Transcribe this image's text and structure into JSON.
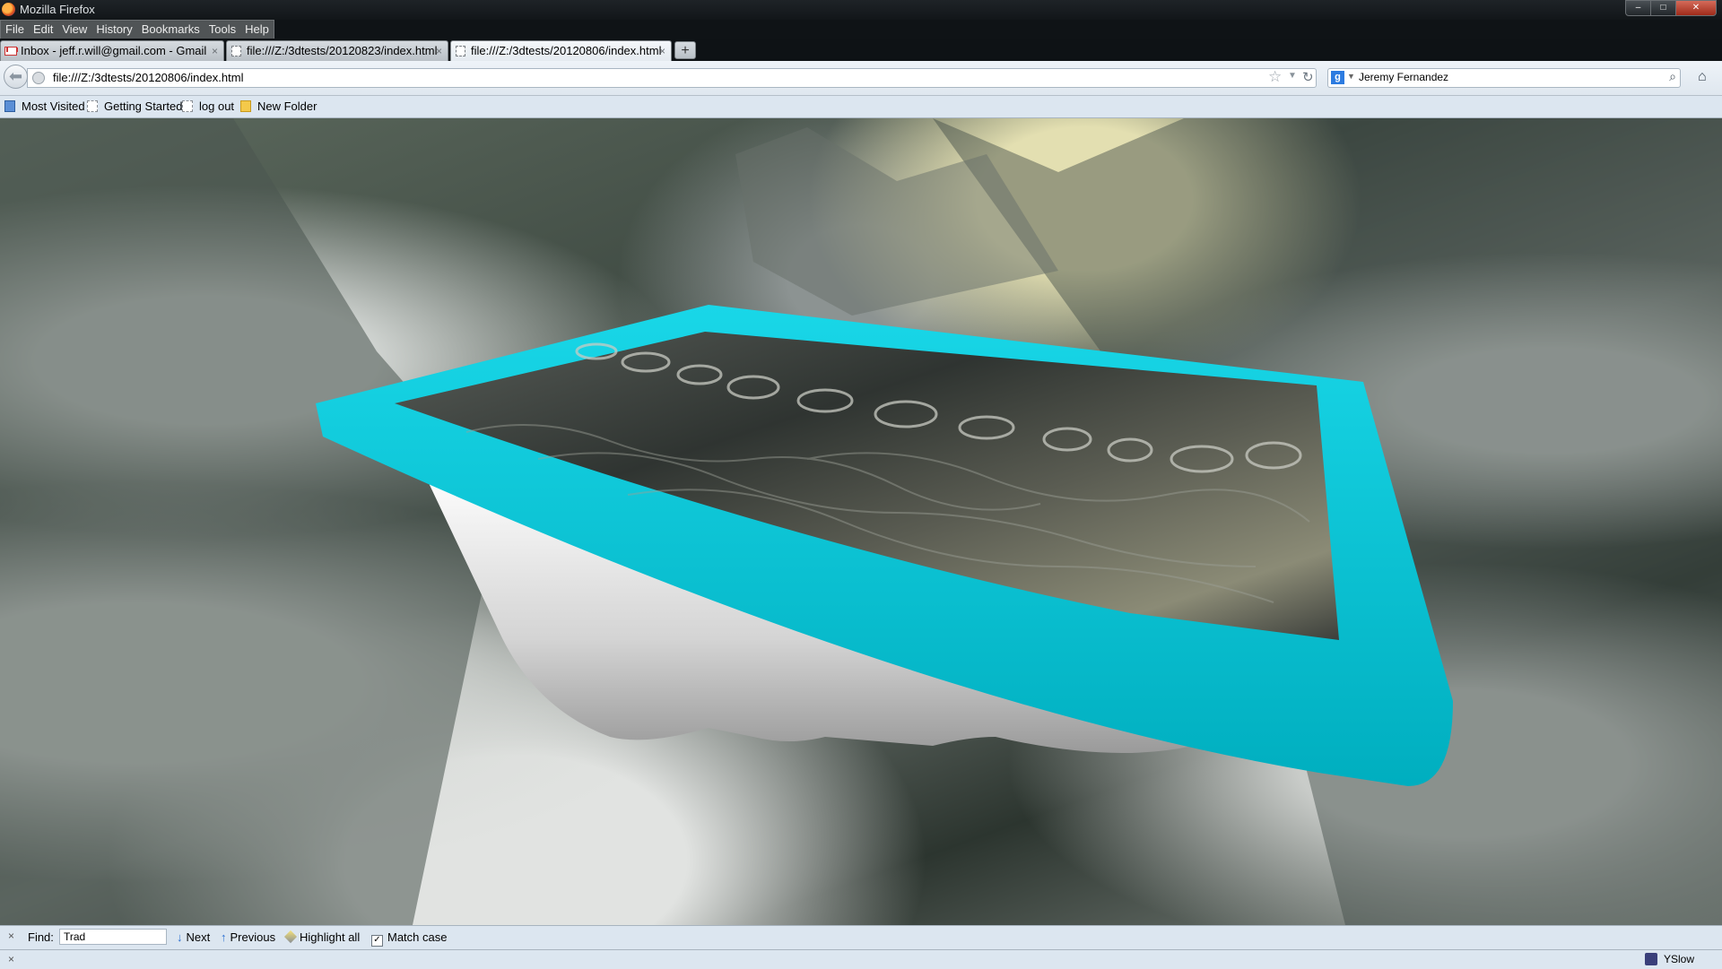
{
  "window": {
    "title": "Mozilla Firefox",
    "min_label": "–",
    "max_label": "□",
    "close_label": "✕"
  },
  "menu": [
    "File",
    "Edit",
    "View",
    "History",
    "Bookmarks",
    "Tools",
    "Help"
  ],
  "tabs": [
    {
      "label": "Inbox - jeff.r.will@gmail.com - Gmail",
      "close": "×",
      "active": false
    },
    {
      "label": "file:///Z:/3dtests/20120823/index.html",
      "close": "×",
      "active": false
    },
    {
      "label": "file:///Z:/3dtests/20120806/index.html",
      "close": "×",
      "active": true
    }
  ],
  "new_tab_label": "+",
  "navbar": {
    "url": "file:///Z:/3dtests/20120806/index.html",
    "search_value": "Jeremy Fernandez",
    "search_engine_letter": "g"
  },
  "bookmarks": [
    "Most Visited",
    "Getting Started",
    "log out",
    "New Folder"
  ],
  "findbar": {
    "close": "×",
    "label": "Find:",
    "value": "Trad",
    "next": "Next",
    "previous": "Previous",
    "highlight_all": "Highlight all",
    "match_case": "Match case",
    "match_case_mark": "✓"
  },
  "statusbar": {
    "close": "×",
    "yslow": "YSlow"
  },
  "colors": {
    "frame_cyan": "#00c2d6",
    "tub_white": "#d8d8d8",
    "liquid": "#3e4340"
  }
}
